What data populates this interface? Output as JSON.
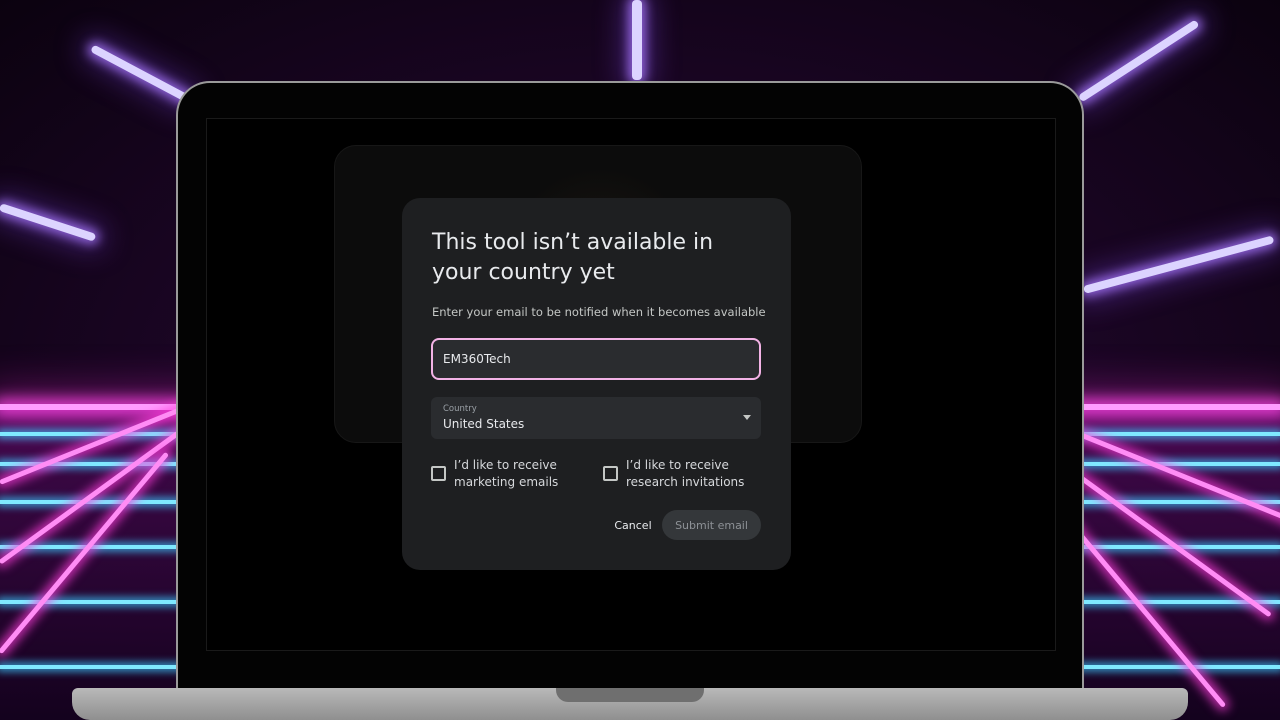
{
  "modal": {
    "title": "This tool isn’t available in your country yet",
    "subtitle": "Enter your email to be notified when it becomes available",
    "email_value": "EM360Tech",
    "country_label": "Country",
    "country_value": "United States",
    "checkbox_marketing": "I’d like to receive marketing emails",
    "checkbox_research": "I’d like to receive research invitations",
    "cancel_label": "Cancel",
    "submit_label": "Submit email"
  },
  "colors": {
    "modal_background": "#1e1f21",
    "input_focus_border": "#f3b3e6",
    "neon_pink": "#ff8cf5",
    "neon_cyan": "#7fe9ff"
  },
  "icons": {
    "dropdown": "triangle-down"
  }
}
